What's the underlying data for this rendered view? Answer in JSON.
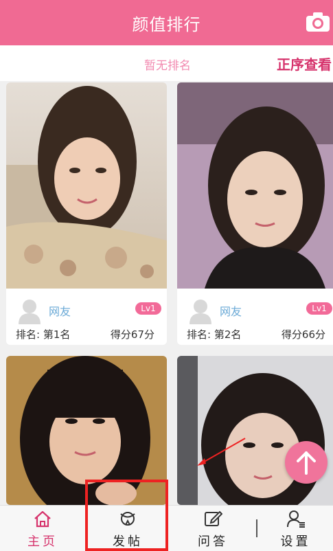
{
  "header": {
    "title": "颜值排行",
    "camera_icon": "camera-icon"
  },
  "subbar": {
    "rank_status": "暂无排名",
    "order_link": "正序查看"
  },
  "cards": [
    {
      "name": "网友",
      "level": "Lv1",
      "rank": "排名: 第1名",
      "score": "得分67分"
    },
    {
      "name": "网友",
      "level": "Lv1",
      "rank": "排名: 第2名",
      "score": "得分66分"
    },
    {},
    {}
  ],
  "tabs": [
    {
      "label": "主页",
      "icon": "home-icon"
    },
    {
      "label": "发帖",
      "icon": "post-icon"
    },
    {
      "label": "问答",
      "icon": "edit-icon"
    },
    {
      "label": "设置",
      "icon": "person-settings-icon"
    }
  ],
  "fab": {
    "icon": "arrow-up-icon"
  },
  "colors": {
    "brand": "#f06a93",
    "accent": "#d6336c",
    "annotation": "#ee2222"
  }
}
